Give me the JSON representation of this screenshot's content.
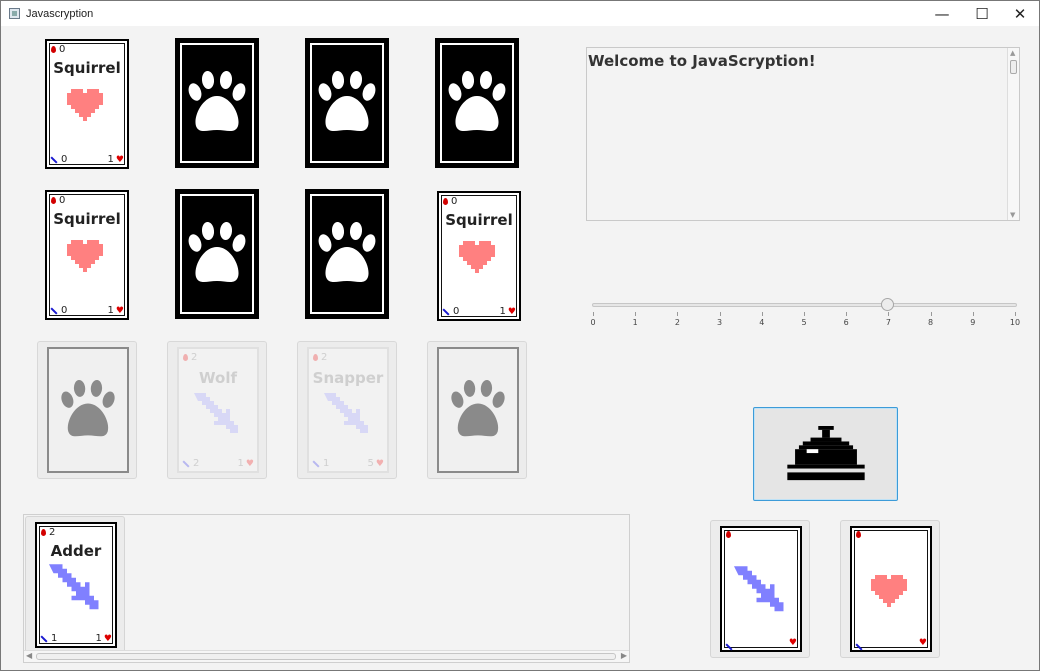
{
  "window": {
    "title": "Javascryption",
    "minimize": "—",
    "maximize": "☐",
    "close": "✕"
  },
  "opponent_queue": [
    {
      "type": "face",
      "name": "Squirrel",
      "cost": "0",
      "attack": "0",
      "health": "1"
    },
    {
      "type": "back"
    },
    {
      "type": "back"
    },
    {
      "type": "back"
    }
  ],
  "opponent_field": [
    {
      "type": "face",
      "name": "Squirrel",
      "cost": "0",
      "attack": "0",
      "health": "1"
    },
    {
      "type": "back"
    },
    {
      "type": "back"
    },
    {
      "type": "face",
      "name": "Squirrel",
      "cost": "0",
      "attack": "0",
      "health": "1"
    }
  ],
  "player_field": [
    {
      "type": "empty"
    },
    {
      "type": "ghost",
      "name": "Wolf",
      "cost": "2",
      "attack": "2",
      "health": "1"
    },
    {
      "type": "ghost",
      "name": "Snapper",
      "cost": "2",
      "attack": "1",
      "health": "5"
    },
    {
      "type": "empty"
    }
  ],
  "log": {
    "text": "Welcome to JavaScryption!"
  },
  "slider": {
    "value": 7,
    "min": 0,
    "max": 10,
    "labels": [
      "0",
      "1",
      "2",
      "3",
      "4",
      "5",
      "6",
      "7",
      "8",
      "9",
      "10"
    ]
  },
  "bell": {
    "icon": "bell-icon"
  },
  "hand": [
    {
      "name": "Adder",
      "cost": "2",
      "attack": "1",
      "health": "1"
    }
  ],
  "decks": [
    {
      "icon": "sword-icon"
    },
    {
      "icon": "heart-icon"
    }
  ],
  "colors": {
    "blood": "#d20000",
    "heart": "#ff8080",
    "sword": "#8080ff",
    "accent": "#3c9bd8"
  }
}
